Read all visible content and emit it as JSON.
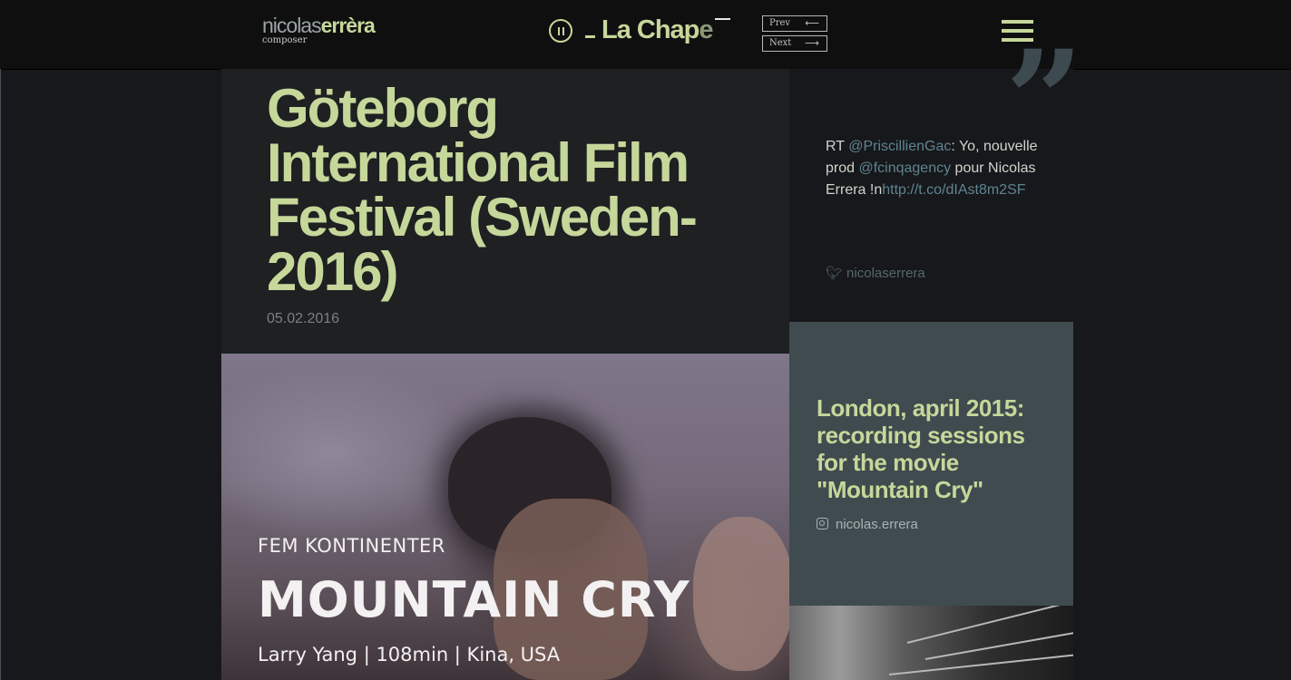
{
  "header": {
    "logo_first": "nicolas",
    "logo_last": "errèra",
    "logo_subtitle": "composer",
    "player_track": "La Chap",
    "player_track_fade": "e",
    "prev_label": "Prev",
    "next_label": "Next",
    "prev_arrow": "⟵",
    "next_arrow": "⟶",
    "play_state": "pause-icon"
  },
  "article": {
    "title": "Göteborg International Film Festival (Sweden-2016)",
    "date": "05.02.2016",
    "image": {
      "subtitle": "FEM KONTINENTER",
      "title": "MOUNTAIN CRY",
      "info": "Larry Yang | 108min | Kina, USA"
    }
  },
  "tweet": {
    "prefix": "RT ",
    "mention1": "@PriscillienGac",
    "text1": ": Yo, nouvelle prod ",
    "mention2": "@fcinqagency",
    "text2": " pour Nicolas Errera !n",
    "link": "http://t.co/dIAst8m2SF",
    "handle": "nicolaserrera",
    "quote_glyph": "”"
  },
  "instagram": {
    "title": "London, april 2015: recording sessions for the movie \"Mountain Cry\"",
    "handle": "nicolas.errera"
  },
  "colors": {
    "accent": "#c6d79a",
    "background": "#17181b",
    "panel": "#1e2022",
    "instagram_panel": "#3f4b4f",
    "link": "#5e8590"
  }
}
